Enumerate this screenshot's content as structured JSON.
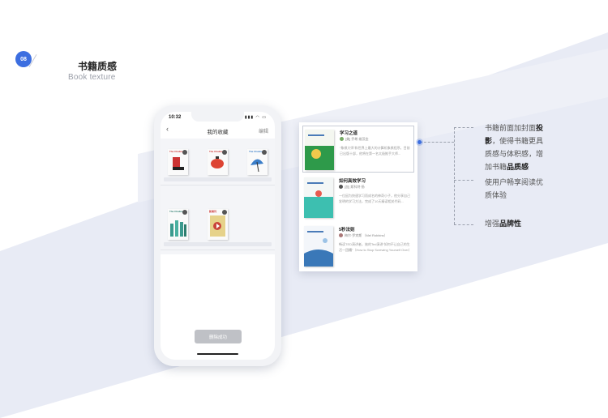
{
  "header": {
    "step": "08",
    "title_cn": "书籍质感",
    "title_en": "Book texture"
  },
  "phone": {
    "status_time": "10:32",
    "status_icons": "▮▮▮ ◠ ▭",
    "nav_title": "我的收藏",
    "nav_edit": "编辑",
    "toast": "删除成功",
    "shelf_books": [
      {
        "name": "book-1",
        "color": "#c33"
      },
      {
        "name": "book-2",
        "color": "#d43"
      },
      {
        "name": "book-3",
        "color": "#3a7dc8"
      },
      {
        "name": "book-4",
        "color": "#3b9a8e"
      },
      {
        "name": "book-5",
        "color": "#c9433a"
      }
    ]
  },
  "list": {
    "items": [
      {
        "title": "学习之道",
        "author": "[美] 乔希·维茨金",
        "desc": "“象棋大师”和世界上最大的计算机象棋程序。目前已出版十部，他将在第一名太极推手大师...",
        "cover_color": "#2e9a4a"
      },
      {
        "title": "如何高效学习",
        "author": "[加] 斯科特·扬",
        "desc": "一位因为快速学习而成名的神奇小子，他分享自己发明的学习方法，完成了10天精读相关代码...",
        "cover_color": "#3dbfb0"
      },
      {
        "title": "5秒法则",
        "author": "梅尔·罗宾斯 （Mel Robbins）",
        "desc": "畅读TED演讲者，她的Ted演讲“如何不让自己的生活一团糟”（How to Stop Screwing Yourself Over）",
        "cover_color": "#3a78b8"
      }
    ]
  },
  "annotations": {
    "a1_pre": "书籍前面加封面",
    "a1_b1": "投影",
    "a1_mid": "，使得书籍更具质感与体积感，增加书籍",
    "a1_b2": "品质感",
    "a2": "使用户畅享阅读优质体验",
    "a3_pre": "增强",
    "a3_b": "品牌性"
  },
  "colors": {
    "accent": "#3c6ee0",
    "band": "#e6e9f4"
  }
}
